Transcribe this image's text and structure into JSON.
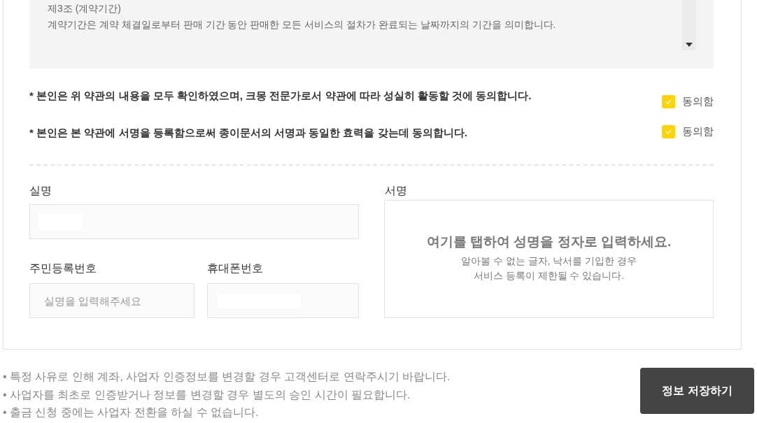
{
  "terms": {
    "heading": "제3조 (계약기간)",
    "body": "계약기간은 계약 체결일로부터 판매 기간 동안 판매한 모든 서비스의 절차가 완료되는 날짜까지의 기간을 의미합니다."
  },
  "agreements": [
    {
      "text": "* 본인은 위 약관의 내용을 모두 확인하였으며, 크몽 전문가로서 약관에 따라 성실히 활동할 것에 동의합니다.",
      "label": "동의함",
      "checked": true
    },
    {
      "text": "* 본인은 본 약관에 서명을 등록함으로써 종이문서의 서명과 동일한 효력을 갖는데 동의합니다.",
      "label": "동의함",
      "checked": true
    }
  ],
  "form": {
    "name": {
      "label": "실명"
    },
    "resident_number": {
      "label": "주민등록번호",
      "placeholder": "실명을 입력해주세요"
    },
    "phone": {
      "label": "휴대폰번호"
    }
  },
  "signature": {
    "label": "서명",
    "prompt": "여기를 탭하여 성명을 정자로 입력하세요.",
    "notice_lines": [
      "알아볼 수 없는 글자, 낙서를 기입한 경우",
      "서비스 등록이 제한될 수 있습니다."
    ]
  },
  "notes": [
    "• 특정 사유로 인해 계좌, 사업자 인증정보를 변경할 경우 고객센터로 연락주시기 바랍니다.",
    "• 사업자를 최초로 인증받거나 정보를 변경할 경우 별도의 승인 시간이 필요합니다.",
    "• 출금 신청 중에는 사업자 전환을 하실 수 없습니다."
  ],
  "save_button": "정보 저장하기"
}
